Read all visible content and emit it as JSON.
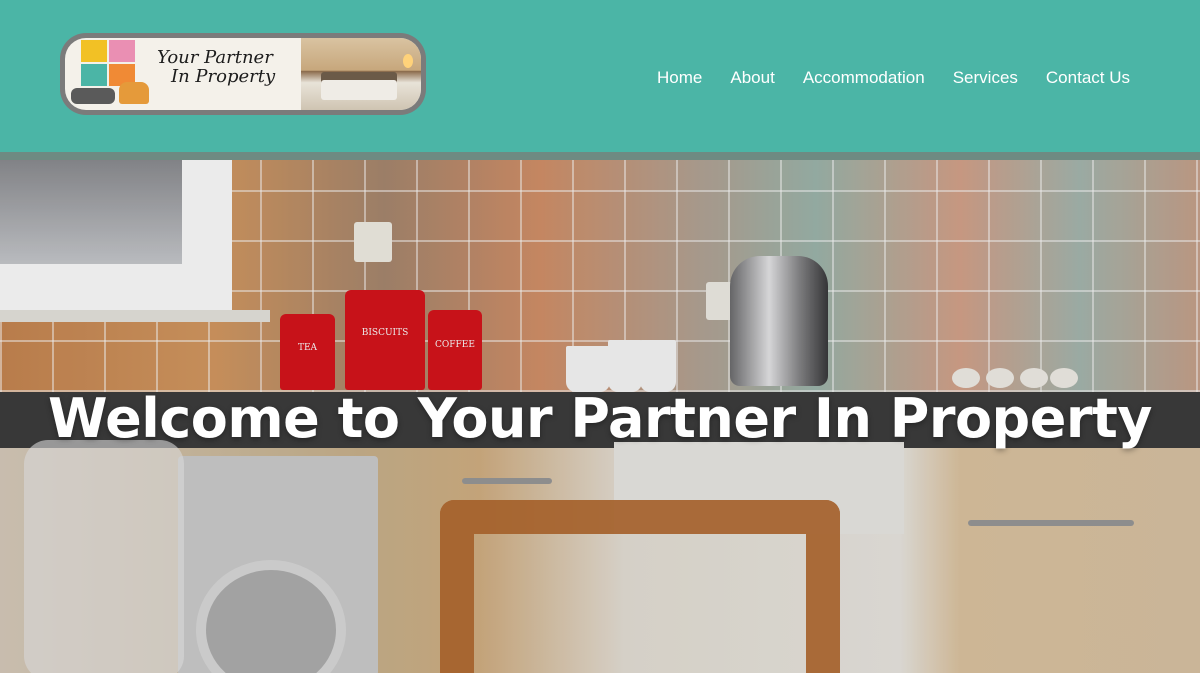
{
  "header": {
    "logo_text_line1": "Your Partner",
    "logo_text_line2": "In Property"
  },
  "nav": {
    "items": [
      {
        "label": "Home"
      },
      {
        "label": "About"
      },
      {
        "label": "Accommodation"
      },
      {
        "label": "Services"
      },
      {
        "label": "Contact Us"
      }
    ]
  },
  "hero": {
    "title": "Welcome to Your Partner In Property",
    "canister_labels": [
      "TEA",
      "BISCUITS",
      "COFFEE"
    ]
  },
  "colors": {
    "header_bg": "#4bb5a6",
    "nav_text": "#ffffff",
    "hero_title": "#ffffff"
  }
}
